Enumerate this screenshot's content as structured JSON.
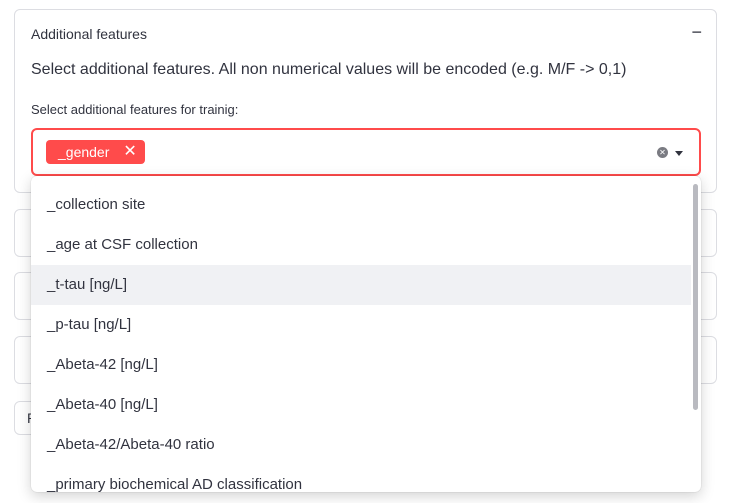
{
  "expander": {
    "title": "Additional features",
    "toggle": "−",
    "description": "Select additional features. All non numerical values will be encoded (e.g. M/F -> 0,1)"
  },
  "multiselect": {
    "label": "Select additional features for trainig:",
    "selected": [
      {
        "label": "_gender",
        "remove": "✕"
      }
    ],
    "clear_glyph": "✕"
  },
  "dropdown": {
    "options": [
      {
        "label": "_collection site"
      },
      {
        "label": "_age at CSF collection"
      },
      {
        "label": "_t-tau [ng/L]",
        "highlighted": true
      },
      {
        "label": "_p-tau [ng/L]"
      },
      {
        "label": "_Abeta-42 [ng/L]"
      },
      {
        "label": "_Abeta-40 [ng/L]"
      },
      {
        "label": "_Abeta-42/Abeta-40 ratio"
      },
      {
        "label": "_primary biochemical AD classification"
      }
    ]
  },
  "background_button": {
    "label": "R"
  },
  "colors": {
    "accent": "#ff4b4b",
    "text": "#31333f",
    "border": "#dcdde2",
    "highlight": "#f0f1f4"
  }
}
